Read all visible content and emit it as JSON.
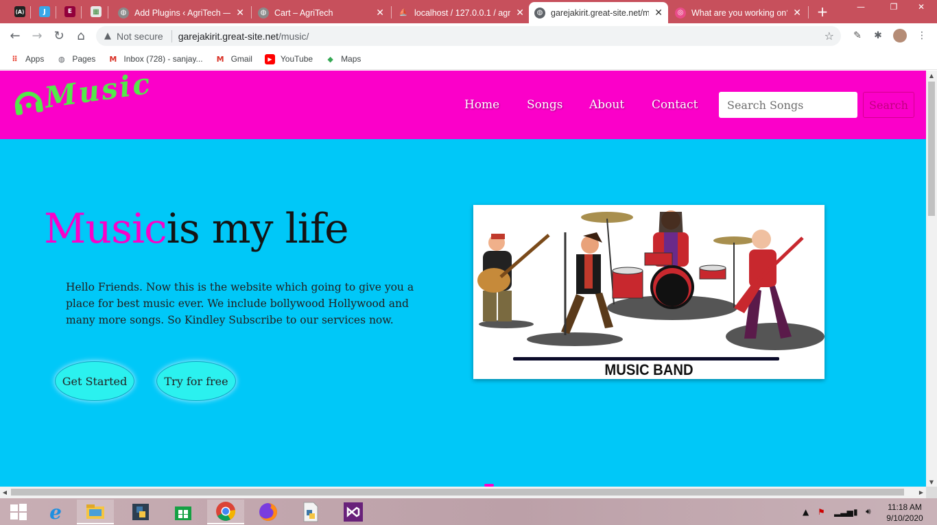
{
  "browser": {
    "tabs": [
      {
        "title": "Add Plugins ‹ AgriTech —",
        "close": "✕",
        "icon": "globe-icon"
      },
      {
        "title": "Cart – AgriTech",
        "close": "✕",
        "icon": "globe-icon"
      },
      {
        "title": "localhost / 127.0.0.1 / agri",
        "close": "✕",
        "icon": "phpmyadmin-icon"
      },
      {
        "title": "garejakirit.great-site.net/m",
        "close": "✕",
        "icon": "globe-icon"
      },
      {
        "title": "What are you working on?",
        "close": "✕",
        "icon": "dribbble-icon"
      }
    ],
    "new_tab": "+",
    "address": {
      "security_label": "Not secure",
      "host": "garejakirit.great-site.net",
      "path": "/music/"
    },
    "bookmarks": [
      {
        "label": "Apps",
        "icon": "apps-grid-icon"
      },
      {
        "label": "Pages",
        "icon": "globe-icon"
      },
      {
        "label": "Inbox (728) - sanjay...",
        "icon": "gmail-icon"
      },
      {
        "label": "Gmail",
        "icon": "gmail-icon"
      },
      {
        "label": "YouTube",
        "icon": "youtube-icon"
      },
      {
        "label": "Maps",
        "icon": "maps-icon"
      }
    ]
  },
  "site": {
    "logo_text": "Music",
    "nav": [
      "Home",
      "Songs",
      "About",
      "Contact"
    ],
    "search_placeholder": "Search Songs",
    "search_button": "Search",
    "hero": {
      "title_accent": "Music",
      "title_rest": "is my life",
      "text": "Hello Friends. Now this is the website which going to give you a place for best music ever. We include bollywood Hollywood and many more songs. So Kindley Subscribe to our services now.",
      "buttons": [
        "Get Started",
        "Try for free"
      ],
      "image_caption": "MUSIC BAND"
    },
    "colors": {
      "nav_bg": "#fb00c9",
      "page_bg": "#00c8f8",
      "logo": "#55e84a",
      "button_bg": "#2bf1ef"
    }
  },
  "taskbar": {
    "apps": [
      "start-icon",
      "internet-explorer-icon",
      "file-explorer-icon",
      "python-idle-icon",
      "store-icon",
      "chrome-icon",
      "firefox-icon",
      "python-file-icon",
      "visual-studio-icon"
    ],
    "time": "11:18 AM",
    "date": "9/10/2020"
  }
}
